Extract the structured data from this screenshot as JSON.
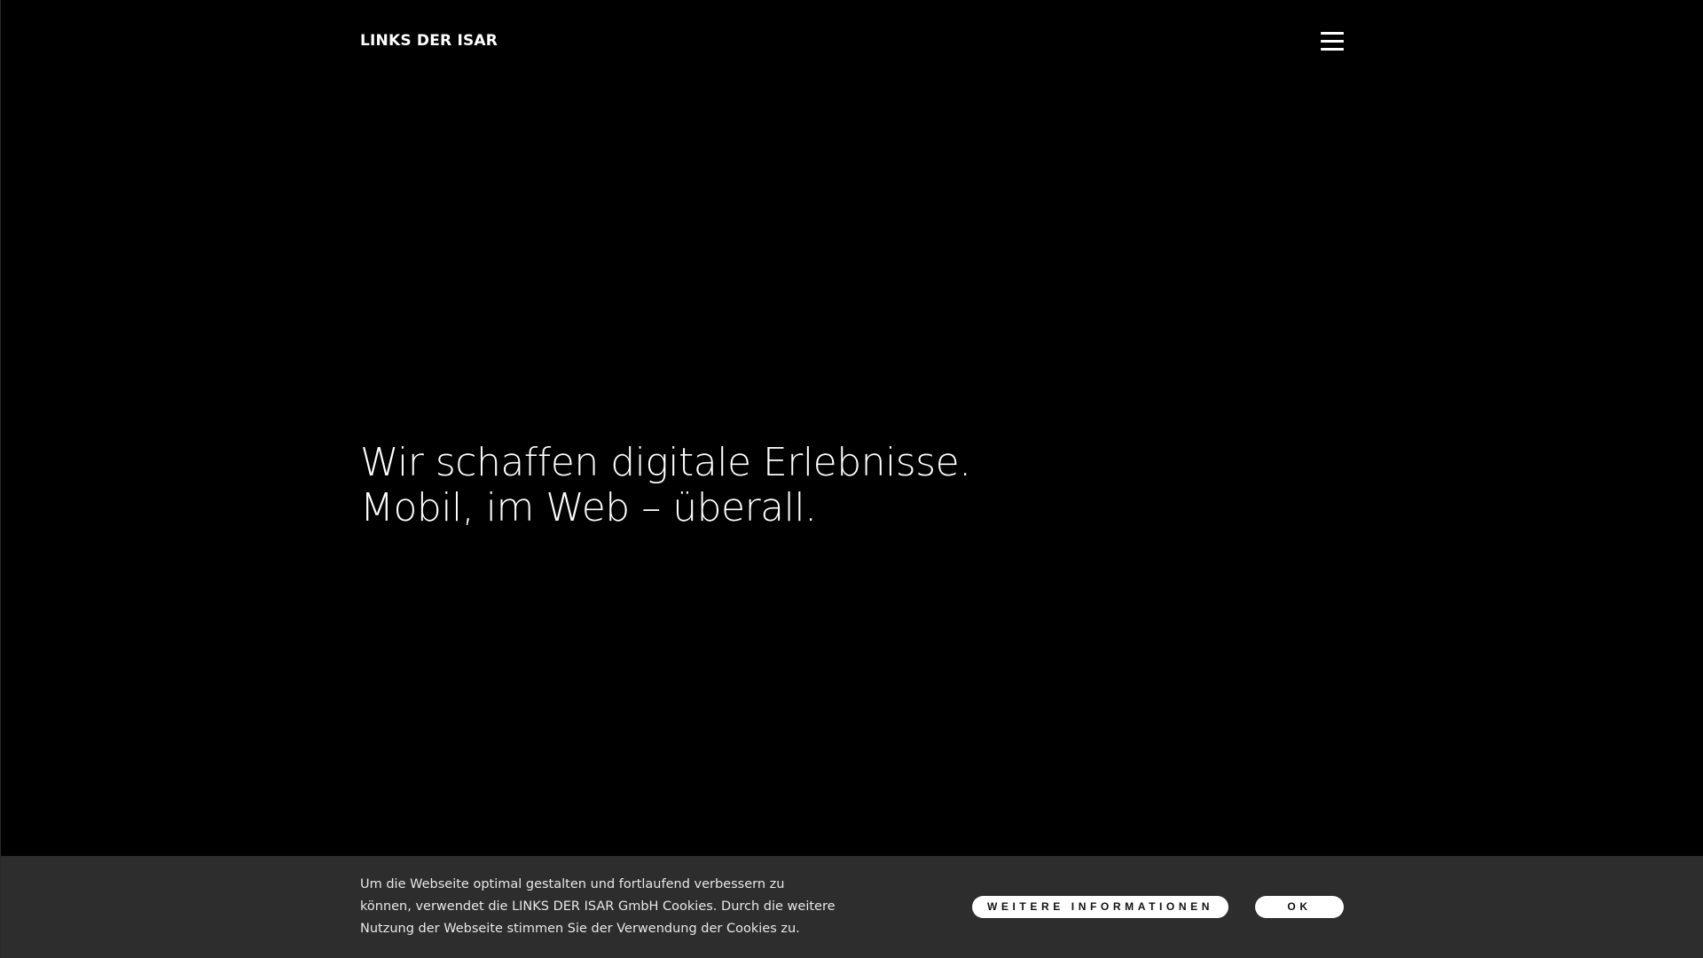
{
  "header": {
    "logo_text": "LINKS DER ISAR",
    "menu_icon": "hamburger-menu-icon"
  },
  "hero": {
    "line1": "Wir schaffen digitale Erlebnisse.",
    "line2": "Mobil, im Web – überall."
  },
  "cookie_banner": {
    "text": "Um die Webseite optimal gestalten und fortlaufend verbessern zu können, verwendet die LINKS DER ISAR GmbH Cookies. Durch die weitere Nutzung der Webseite stimmen Sie der Verwendung der Cookies zu.",
    "more_info_label": "WEITERE INFORMATIONEN",
    "ok_label": "OK"
  },
  "colors": {
    "background": "#000000",
    "text": "#ffffff",
    "cookie_bar_background": "#2d2d2d",
    "button_background": "#ffffff",
    "button_text": "#111111"
  }
}
